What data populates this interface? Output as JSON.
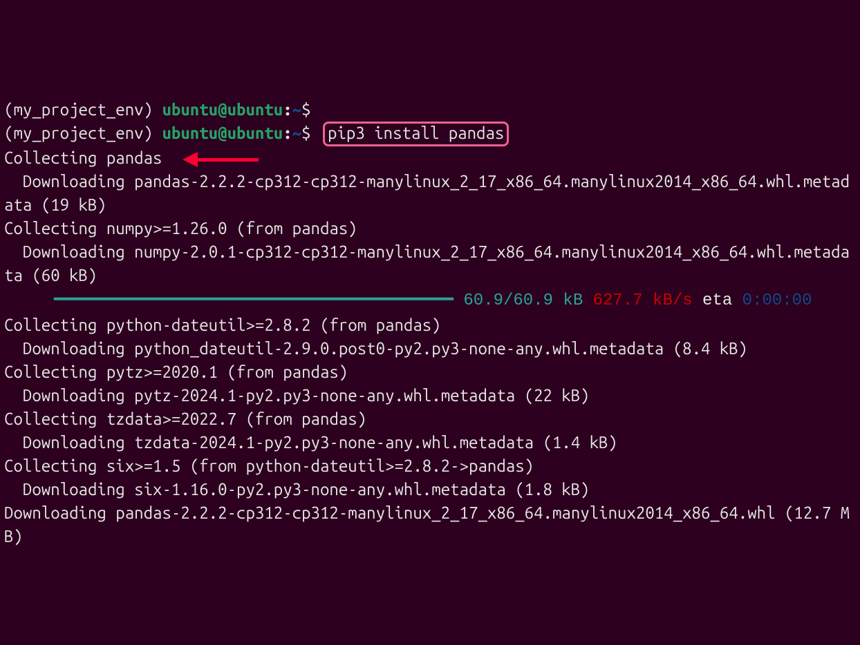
{
  "prompt1": {
    "env": "(my_project_env) ",
    "user": "ubuntu@ubuntu",
    "colon": ":",
    "path": "~",
    "dollar": "$ "
  },
  "prompt2": {
    "env": "(my_project_env) ",
    "user": "ubuntu@ubuntu",
    "colon": ":",
    "path": "~",
    "dollar": "$ ",
    "command": "pip3 install pandas"
  },
  "lines": {
    "l01": "Collecting pandas",
    "l02": "  Downloading pandas-2.2.2-cp312-cp312-manylinux_2_17_x86_64.manylinux2014_x86_64.whl.metadata (19 kB)",
    "l03": "Collecting numpy>=1.26.0 (from pandas)",
    "l04": "  Downloading numpy-2.0.1-cp312-cp312-manylinux_2_17_x86_64.manylinux2014_x86_64.whl.metadata (60 kB)",
    "bar": {
      "indent": "     ",
      "fill": "━━━━━━━━━━━━━━━━━━━━━━━━━━━━━━━━━━━━━━━━",
      "size": " 60.9/60.9 kB",
      "rate": " 627.7 kB/s",
      "eta_label": " eta ",
      "eta_time": "0:00:00"
    },
    "l05": "Collecting python-dateutil>=2.8.2 (from pandas)",
    "l06": "  Downloading python_dateutil-2.9.0.post0-py2.py3-none-any.whl.metadata (8.4 kB)",
    "l07": "Collecting pytz>=2020.1 (from pandas)",
    "l08": "  Downloading pytz-2024.1-py2.py3-none-any.whl.metadata (22 kB)",
    "l09": "Collecting tzdata>=2022.7 (from pandas)",
    "l10": "  Downloading tzdata-2024.1-py2.py3-none-any.whl.metadata (1.4 kB)",
    "l11": "Collecting six>=1.5 (from python-dateutil>=2.8.2->pandas)",
    "l12": "  Downloading six-1.16.0-py2.py3-none-any.whl.metadata (1.8 kB)",
    "l13": "Downloading pandas-2.2.2-cp312-cp312-manylinux_2_17_x86_64.manylinux2014_x86_64.whl (12.7 MB)"
  },
  "annotations": {
    "command_highlight_color": "#f06292",
    "arrow_color": "#ff0033"
  }
}
